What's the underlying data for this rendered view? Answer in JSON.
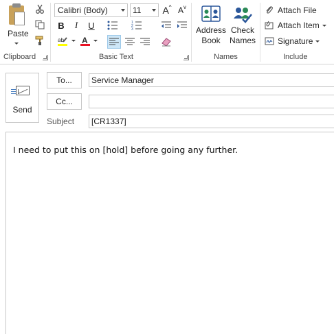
{
  "ribbon": {
    "clipboard": {
      "paste_label": "Paste",
      "group_label": "Clipboard",
      "cut_icon": "scissors-icon",
      "copy_icon": "copy-icon",
      "format_painter_icon": "format-painter-icon"
    },
    "basic_text": {
      "font_name": "Calibri (Body)",
      "font_size": "11",
      "group_label": "Basic Text",
      "bold": "B",
      "italic": "I",
      "underline": "U",
      "grow_font": "A",
      "shrink_font": "A",
      "highlight_color": "#ffff00",
      "font_color": "#e81123",
      "align_active": "left"
    },
    "names": {
      "address_book_line1": "Address",
      "address_book_line2": "Book",
      "check_names_line1": "Check",
      "check_names_line2": "Names",
      "group_label": "Names"
    },
    "include": {
      "attach_file": "Attach File",
      "attach_item": "Attach Item",
      "signature": "Signature",
      "group_label": "Include"
    }
  },
  "compose": {
    "send_label": "Send",
    "to_label": "To...",
    "cc_label": "Cc...",
    "subject_label": "Subject",
    "to_value": "Service Manager",
    "cc_value": "",
    "subject_value": "[CR1337]",
    "body_text": "I need to put this on [hold] before going any further."
  }
}
